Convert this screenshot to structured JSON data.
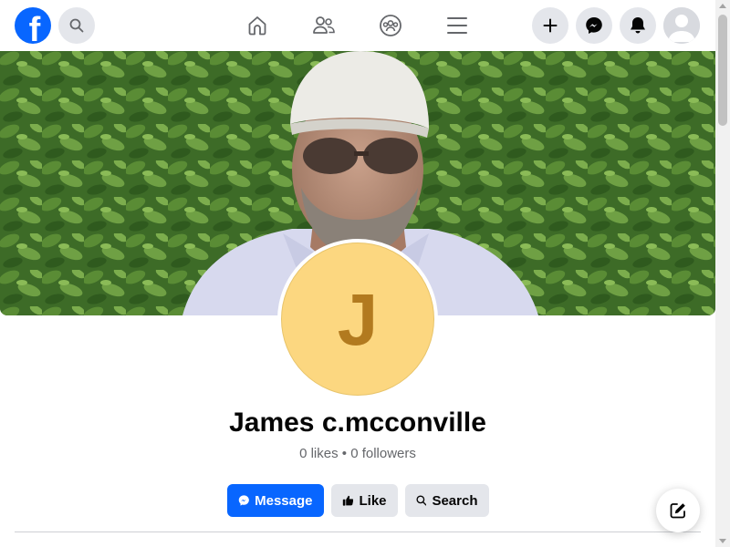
{
  "topbar": {
    "logo": "facebook-logo",
    "logo_letter": "f",
    "icons": [
      "search-icon",
      "home-icon",
      "friends-icon",
      "groups-icon",
      "menu-icon",
      "plus-icon",
      "messenger-icon",
      "bell-icon",
      "avatar-icon"
    ]
  },
  "profile": {
    "avatar_initial": "J",
    "name": "James c.mcconville",
    "stats": "0 likes • 0 followers"
  },
  "actions": {
    "message_label": "Message",
    "like_label": "Like",
    "search_label": "Search"
  },
  "colors": {
    "brand": "#0866ff",
    "button_gray": "#e4e6eb",
    "avatar_bg": "#fcd780",
    "avatar_letter": "#b27a1f",
    "secondary_text": "#65676b"
  }
}
